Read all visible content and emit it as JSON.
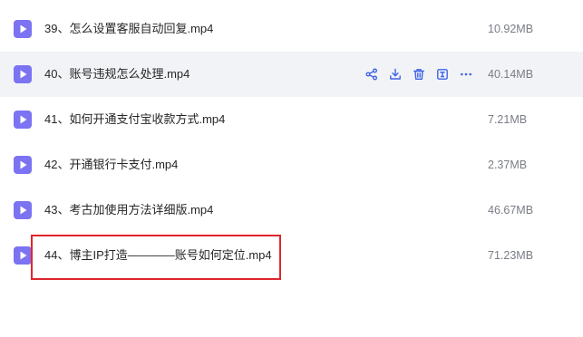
{
  "files": [
    {
      "name": "39、怎么设置客服自动回复.mp4",
      "size": "10.92MB",
      "icon": "video-file-icon"
    },
    {
      "name": "40、账号违规怎么处理.mp4",
      "size": "40.14MB",
      "icon": "video-file-icon"
    },
    {
      "name": "41、如何开通支付宝收款方式.mp4",
      "size": "7.21MB",
      "icon": "video-file-icon"
    },
    {
      "name": "42、开通银行卡支付.mp4",
      "size": "2.37MB",
      "icon": "video-file-icon"
    },
    {
      "name": "43、考古加使用方法详细版.mp4",
      "size": "46.67MB",
      "icon": "video-file-icon"
    },
    {
      "name": "44、博主IP打造————账号如何定位.mp4",
      "size": "71.23MB",
      "icon": "video-file-icon"
    }
  ],
  "row_actions": [
    "share-icon",
    "download-icon",
    "delete-icon",
    "rename-icon",
    "more-icon"
  ],
  "colors": {
    "accent": "#3d63e6",
    "file_icon": "#7b73f2",
    "hover_row": "#f2f3f6",
    "highlight_border": "#e0252e",
    "size_text": "#7a7d85"
  }
}
